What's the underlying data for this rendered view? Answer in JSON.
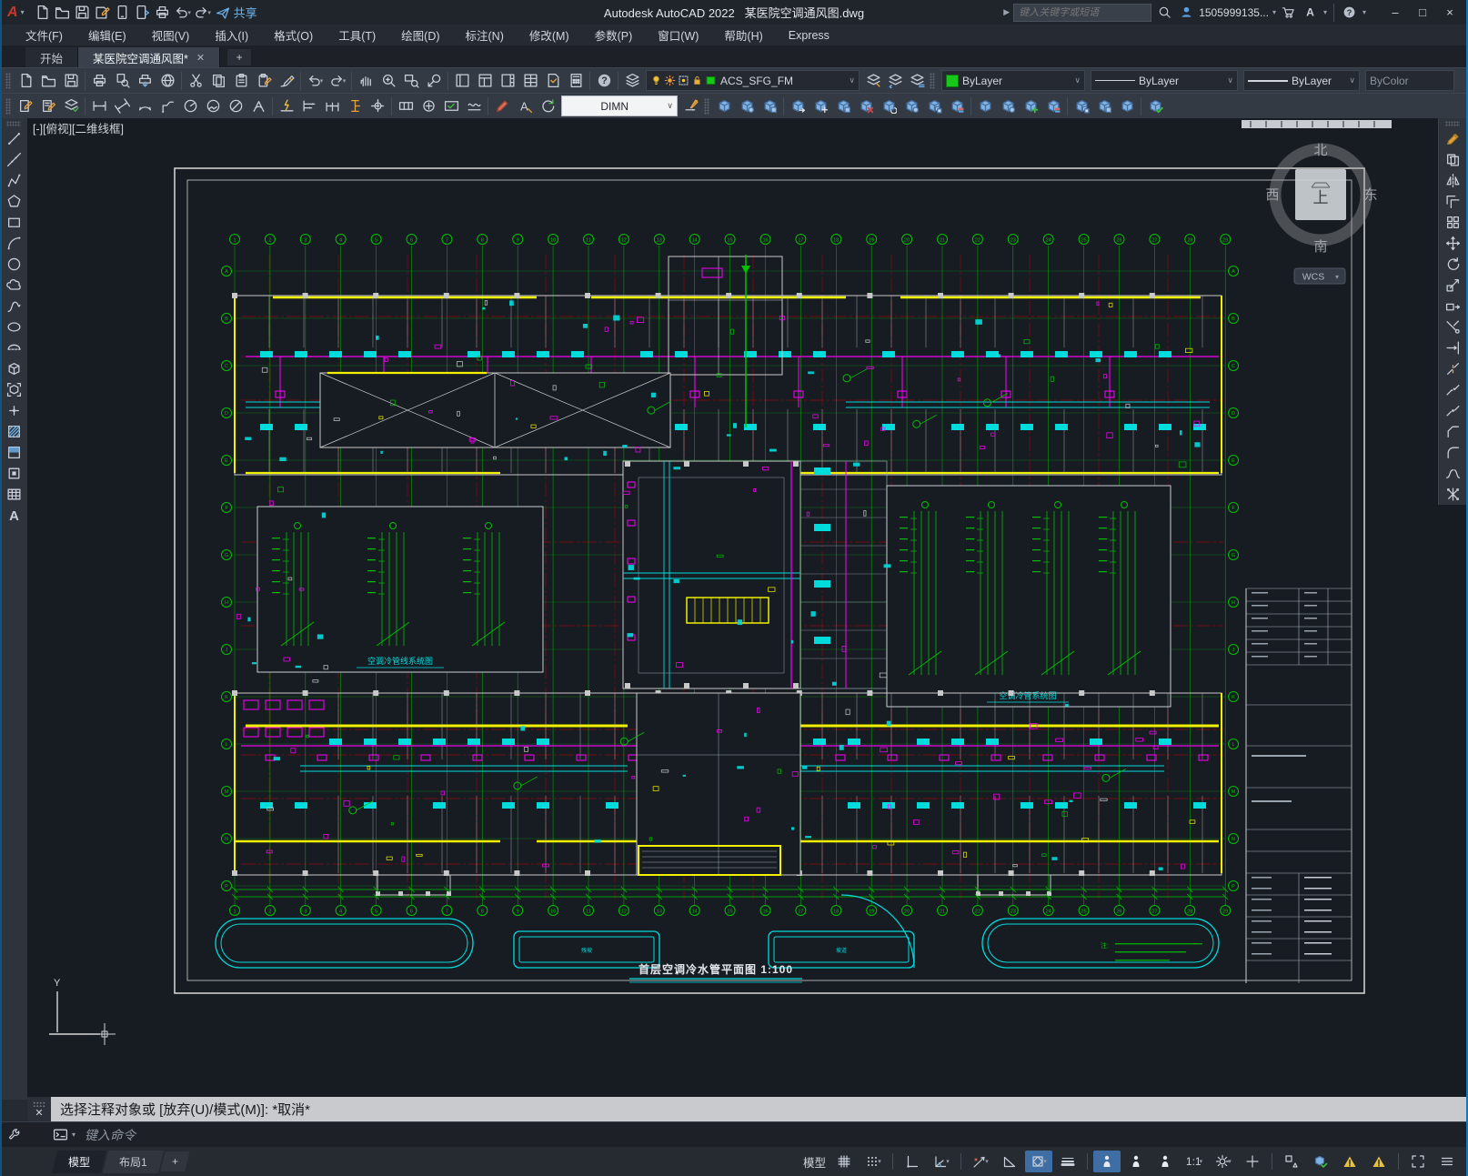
{
  "window": {
    "logo_letter": "A",
    "app_title": "Autodesk AutoCAD 2022",
    "doc_name": "某医院空调通风图.dwg",
    "share_label": "共享",
    "search_placeholder": "键入关键字或短语",
    "account_id": "1505999135...",
    "minimize_glyph": "–",
    "maximize_glyph": "□",
    "close_glyph": "×"
  },
  "menu": {
    "items": [
      "文件(F)",
      "编辑(E)",
      "视图(V)",
      "插入(I)",
      "格式(O)",
      "工具(T)",
      "绘图(D)",
      "标注(N)",
      "修改(M)",
      "参数(P)",
      "窗口(W)",
      "帮助(H)",
      "Express"
    ]
  },
  "file_tabs": {
    "start_tab": "开始",
    "active_tab": "某医院空调通风图*",
    "close_glyph": "✕",
    "new_tab_glyph": "+"
  },
  "toolbar": {
    "layer_combo": "ACS_SFG_FM",
    "color_combo": "ByLayer",
    "linetype_combo": "ByLayer",
    "lineweight_combo": "ByLayer",
    "plot_style_combo": "ByColor",
    "dim_style_combo": "DIMN"
  },
  "qat": [
    {
      "name": "new-file",
      "icon": "doc"
    },
    {
      "name": "open-file",
      "icon": "folder"
    },
    {
      "name": "save",
      "icon": "disk"
    },
    {
      "name": "save-as",
      "icon": "diskp"
    },
    {
      "name": "open-from-mobile",
      "icon": "device"
    },
    {
      "name": "save-to-mobile",
      "icon": "devicea"
    },
    {
      "name": "plot",
      "icon": "printer"
    },
    {
      "name": "undo",
      "icon": "undo",
      "dd": true
    },
    {
      "name": "redo",
      "icon": "redo",
      "dd": true
    },
    {
      "name": "share",
      "icon": "plane"
    }
  ],
  "toolbar1_groups": [
    [
      {
        "name": "new",
        "icon": "doc"
      },
      {
        "name": "open",
        "icon": "folder"
      },
      {
        "name": "save",
        "icon": "disk"
      }
    ],
    [
      {
        "name": "plot",
        "icon": "printer"
      },
      {
        "name": "plot-preview",
        "icon": "preview"
      },
      {
        "name": "publish",
        "icon": "publish"
      },
      {
        "name": "web",
        "icon": "globe"
      }
    ],
    [
      {
        "name": "cut",
        "icon": "cut"
      },
      {
        "name": "copy",
        "icon": "copy"
      },
      {
        "name": "paste",
        "icon": "paste"
      },
      {
        "name": "paste-special",
        "icon": "paste2"
      },
      {
        "name": "match-properties",
        "icon": "brush"
      }
    ],
    [
      {
        "name": "undo",
        "icon": "undo",
        "dd": true
      },
      {
        "name": "redo",
        "icon": "redo",
        "dd": true
      }
    ],
    [
      {
        "name": "pan",
        "icon": "hand"
      },
      {
        "name": "zoom-realtime",
        "icon": "zoom"
      },
      {
        "name": "zoom-window",
        "icon": "zoomw"
      },
      {
        "name": "zoom-previous",
        "icon": "zoomp"
      }
    ],
    [
      {
        "name": "properties-palette",
        "icon": "panel"
      },
      {
        "name": "design-center",
        "icon": "panel2"
      },
      {
        "name": "tool-palettes",
        "icon": "panel3"
      },
      {
        "name": "sheet-set-manager",
        "icon": "panel4"
      },
      {
        "name": "markup",
        "icon": "markup"
      },
      {
        "name": "quick-calc",
        "icon": "calc"
      }
    ],
    [
      {
        "name": "help",
        "icon": "help"
      }
    ]
  ],
  "layer_tools_left": [
    {
      "name": "layer-properties",
      "icon": "layers"
    }
  ],
  "layer_tools_right": [
    {
      "name": "make-object-layer-current",
      "icon": "layers2"
    },
    {
      "name": "layer-previous",
      "icon": "layers3"
    },
    {
      "name": "layer-states",
      "icon": "layers4"
    }
  ],
  "layer_combo_icons": [
    "bulb",
    "sun",
    "vframe",
    "lock",
    "sqg"
  ],
  "toolbar2_groups": [
    [
      {
        "name": "dim-edit",
        "icon": "editpencil"
      },
      {
        "name": "dim-text-edit",
        "icon": "editpencil2"
      },
      {
        "name": "dim-update-style",
        "icon": "styleupd"
      }
    ],
    [
      {
        "name": "dim-linear",
        "icon": "dim"
      },
      {
        "name": "dim-aligned",
        "icon": "dima"
      },
      {
        "name": "dim-arc-length",
        "icon": "dimarc"
      },
      {
        "name": "dim-ordinate",
        "icon": "dimord"
      },
      {
        "name": "dim-radius",
        "icon": "dimrad"
      },
      {
        "name": "dim-jogged",
        "icon": "dimjog"
      },
      {
        "name": "dim-diameter",
        "icon": "dimdia"
      },
      {
        "name": "dim-angular",
        "icon": "dimang"
      }
    ],
    [
      {
        "name": "quick-dimension",
        "icon": "qdim"
      },
      {
        "name": "dim-baseline",
        "icon": "dimbase"
      },
      {
        "name": "dim-continue",
        "icon": "dimcont"
      },
      {
        "name": "dim-spacing",
        "icon": "dimI"
      },
      {
        "name": "dim-break",
        "icon": "dimctr"
      }
    ],
    [
      {
        "name": "tolerance",
        "icon": "boxed"
      },
      {
        "name": "center-mark",
        "icon": "circplus"
      },
      {
        "name": "dim-inspect",
        "icon": "boxcheck"
      },
      {
        "name": "dim-jog-line",
        "icon": "wave"
      }
    ],
    [
      {
        "name": "dim-text-edit2",
        "icon": "redpencil"
      },
      {
        "name": "dim-text-angle",
        "icon": "atext"
      },
      {
        "name": "dim-update",
        "icon": "refresh"
      }
    ]
  ],
  "toolbar2_solids": [
    [
      {
        "name": "solid-union",
        "icon": "cube"
      },
      {
        "name": "solid-subtract",
        "icon": "cube2"
      },
      {
        "name": "solid-intersect",
        "icon": "cube3"
      }
    ],
    [
      {
        "name": "extrude-faces",
        "icon": "cube_arrow"
      },
      {
        "name": "move-faces",
        "icon": "cube_move"
      },
      {
        "name": "offset-faces",
        "icon": "cube3"
      },
      {
        "name": "delete-faces",
        "icon": "cube_x"
      },
      {
        "name": "rotate-faces",
        "icon": "cube_rot"
      },
      {
        "name": "taper-faces",
        "icon": "cube2"
      },
      {
        "name": "copy-faces",
        "icon": "cube_copy"
      },
      {
        "name": "color-faces",
        "icon": "cube_color"
      }
    ],
    [
      {
        "name": "clean-body",
        "icon": "cube"
      },
      {
        "name": "shell-body",
        "icon": "cube2"
      },
      {
        "name": "imprint-edges",
        "icon": "cube_plus"
      },
      {
        "name": "color-edges",
        "icon": "cube_color"
      }
    ],
    [
      {
        "name": "copy-edges",
        "icon": "cube_copy"
      },
      {
        "name": "extract-edges",
        "icon": "cube3"
      },
      {
        "name": "offset-edge",
        "icon": "cube"
      }
    ],
    [
      {
        "name": "check-solid",
        "icon": "cube_check"
      }
    ]
  ],
  "dim_style_tools": [
    {
      "name": "dim-style-apply",
      "icon": "dimapply"
    }
  ],
  "draw_toolbar": [
    {
      "name": "line",
      "icon": "line"
    },
    {
      "name": "construction-line",
      "icon": "xline"
    },
    {
      "name": "polyline",
      "icon": "pline"
    },
    {
      "name": "polygon",
      "icon": "polygon"
    },
    {
      "name": "rectangle",
      "icon": "rect"
    },
    {
      "name": "arc",
      "icon": "arc"
    },
    {
      "name": "circle",
      "icon": "circle"
    },
    {
      "name": "revision-cloud",
      "icon": "cloud"
    },
    {
      "name": "spline",
      "icon": "spline"
    },
    {
      "name": "ellipse",
      "icon": "ellipse"
    },
    {
      "name": "ellipse-arc",
      "icon": "earc"
    },
    {
      "name": "insert-block",
      "icon": "iblock"
    },
    {
      "name": "make-block",
      "icon": "mblock"
    },
    {
      "name": "point",
      "icon": "point"
    },
    {
      "name": "hatch",
      "icon": "hatch"
    },
    {
      "name": "gradient",
      "icon": "gradient"
    },
    {
      "name": "region",
      "icon": "region"
    },
    {
      "name": "table",
      "icon": "table"
    },
    {
      "name": "multiline-text",
      "icon": "mtext"
    }
  ],
  "modify_toolbar": [
    {
      "name": "erase",
      "icon": "erase"
    },
    {
      "name": "copy",
      "icon": "mcopy"
    },
    {
      "name": "mirror",
      "icon": "mirror"
    },
    {
      "name": "offset",
      "icon": "offset"
    },
    {
      "name": "array",
      "icon": "array"
    },
    {
      "name": "move",
      "icon": "move"
    },
    {
      "name": "rotate",
      "icon": "rotate"
    },
    {
      "name": "scale",
      "icon": "scalei"
    },
    {
      "name": "stretch",
      "icon": "stretch"
    },
    {
      "name": "trim",
      "icon": "trim"
    },
    {
      "name": "extend",
      "icon": "extend"
    },
    {
      "name": "break-at-point",
      "icon": "brkpt"
    },
    {
      "name": "break",
      "icon": "brk"
    },
    {
      "name": "join",
      "icon": "join"
    },
    {
      "name": "chamfer",
      "icon": "chamfer"
    },
    {
      "name": "fillet",
      "icon": "fillet"
    },
    {
      "name": "blend-curves",
      "icon": "blend"
    },
    {
      "name": "explode",
      "icon": "explode"
    }
  ],
  "status_icons": [
    {
      "name": "grid-display",
      "icon": "sgrid"
    },
    {
      "name": "snap-mode",
      "icon": "sdots",
      "dd": true
    },
    {
      "sep": true
    },
    {
      "name": "ortho-mode",
      "icon": "sortho"
    },
    {
      "name": "polar-tracking",
      "icon": "spolar",
      "dd": true
    },
    {
      "sep": true
    },
    {
      "name": "object-snap-tracking",
      "icon": "strack",
      "dd": true
    },
    {
      "name": "isometric-drafting",
      "icon": "sangle"
    },
    {
      "name": "dynamic-input",
      "icon": "sosnap",
      "dd": true,
      "active": true
    },
    {
      "name": "lineweight-display",
      "icon": "slw"
    },
    {
      "sep": true
    },
    {
      "name": "annotation-visibility",
      "icon": "sanno",
      "active": true
    },
    {
      "name": "autoscale-annotation",
      "icon": "sanno"
    },
    {
      "name": "annotation-scale-icon",
      "icon": "sanno"
    },
    {
      "name": "annotation-scale",
      "text": "1:1",
      "dd": true
    },
    {
      "name": "workspace-switching",
      "icon": "sgear",
      "dd": true
    },
    {
      "name": "annotation-monitor",
      "icon": "splus"
    },
    {
      "sep": true
    },
    {
      "name": "isolate-objects",
      "icon": "siso"
    },
    {
      "name": "graphics-performance",
      "icon": "sperf"
    },
    {
      "name": "performance-warning",
      "icon": "swarn"
    },
    {
      "name": "hardware-warning",
      "icon": "swarn"
    },
    {
      "sep": true
    },
    {
      "name": "clean-screen",
      "icon": "sfull"
    },
    {
      "name": "customization",
      "icon": "sburger"
    }
  ],
  "canvas": {
    "viewport_label": "[-][俯视][二维线框]",
    "drawing_title": "首层空调冷水管平面图",
    "drawing_scale": "1:100",
    "panel1_label": "空调冷管线系统图",
    "panel2_label": "空调冷管系统图",
    "ucs_y_label": "Y",
    "viewcube": {
      "north": "北",
      "south": "南",
      "west": "西",
      "east": "东",
      "top": "上",
      "wcs_label": "WCS"
    },
    "colors": {
      "background": "#171c23",
      "grid_green": "#00c000",
      "axis_red": "#b40000",
      "duct_magenta": "#ff00ff",
      "equipment_cyan": "#00dcdc",
      "wall_yellow": "#f0f000",
      "wall_white": "#c8c8c8",
      "frame_white": "#cfcfcf"
    }
  },
  "command": {
    "history_line": "选择注释对象或 [放弃(U)/模式(M)]: *取消*",
    "input_placeholder": "键入命令"
  },
  "status_bar": {
    "model_button": "模型",
    "layout_tabs": [
      "模型",
      "布局1"
    ],
    "new_layout_glyph": "+"
  }
}
